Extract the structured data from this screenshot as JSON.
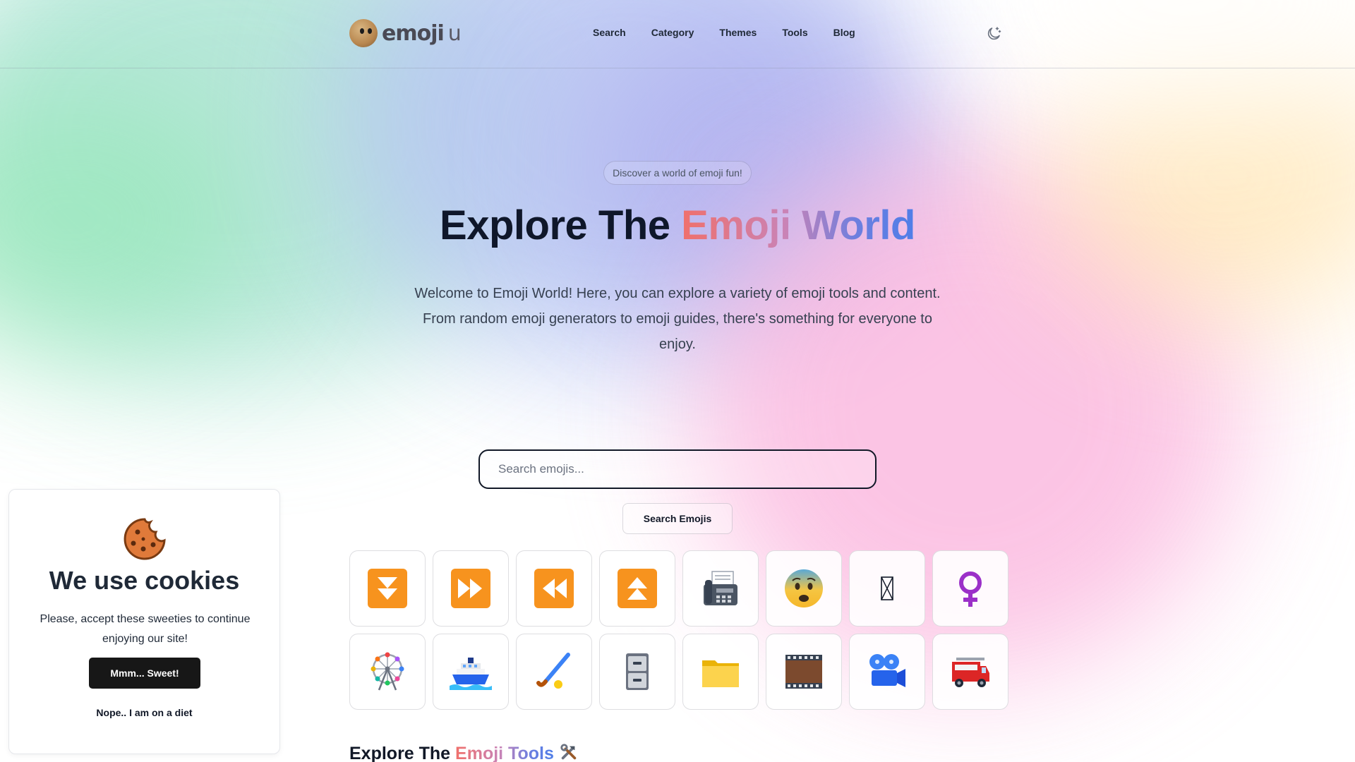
{
  "header": {
    "logo_text": "emoji",
    "logo_suffix": "u",
    "nav": [
      {
        "label": "Search"
      },
      {
        "label": "Category"
      },
      {
        "label": "Themes"
      },
      {
        "label": "Tools"
      },
      {
        "label": "Blog"
      }
    ],
    "theme_icon": "moon-stars-icon"
  },
  "hero": {
    "badge": "Discover a world of emoji fun!",
    "title_plain": "Explore The",
    "title_highlight": "Emoji World",
    "description": "Welcome to Emoji World! Here, you can explore a variety of emoji tools and content. From random emoji generators to emoji guides, there's something for everyone to enjoy."
  },
  "search": {
    "placeholder": "Search emojis...",
    "button_label": "Search Emojis"
  },
  "emoji_grid": [
    {
      "icon": "fast-down-button-icon"
    },
    {
      "icon": "fast-forward-button-icon"
    },
    {
      "icon": "fast-reverse-button-icon"
    },
    {
      "icon": "fast-up-button-icon"
    },
    {
      "icon": "fax-machine-icon"
    },
    {
      "icon": "fearful-face-icon"
    },
    {
      "icon": "missing-glyph-icon"
    },
    {
      "icon": "female-sign-icon"
    },
    {
      "icon": "ferris-wheel-icon"
    },
    {
      "icon": "ferry-icon"
    },
    {
      "icon": "field-hockey-icon"
    },
    {
      "icon": "file-cabinet-icon"
    },
    {
      "icon": "file-folder-icon"
    },
    {
      "icon": "film-frames-icon"
    },
    {
      "icon": "film-projector-icon"
    },
    {
      "icon": "fire-engine-icon"
    }
  ],
  "tools_section": {
    "title_plain": "Explore The",
    "title_highlight": "Emoji Tools",
    "icon": "hammer-and-wrench-icon"
  },
  "cookie_banner": {
    "title": "We use cookies",
    "text": "Please, accept these sweeties to continue enjoying our site!",
    "accept_label": "Mmm... Sweet!",
    "decline_label": "Nope.. I am on a diet",
    "icon": "cookie-icon"
  }
}
